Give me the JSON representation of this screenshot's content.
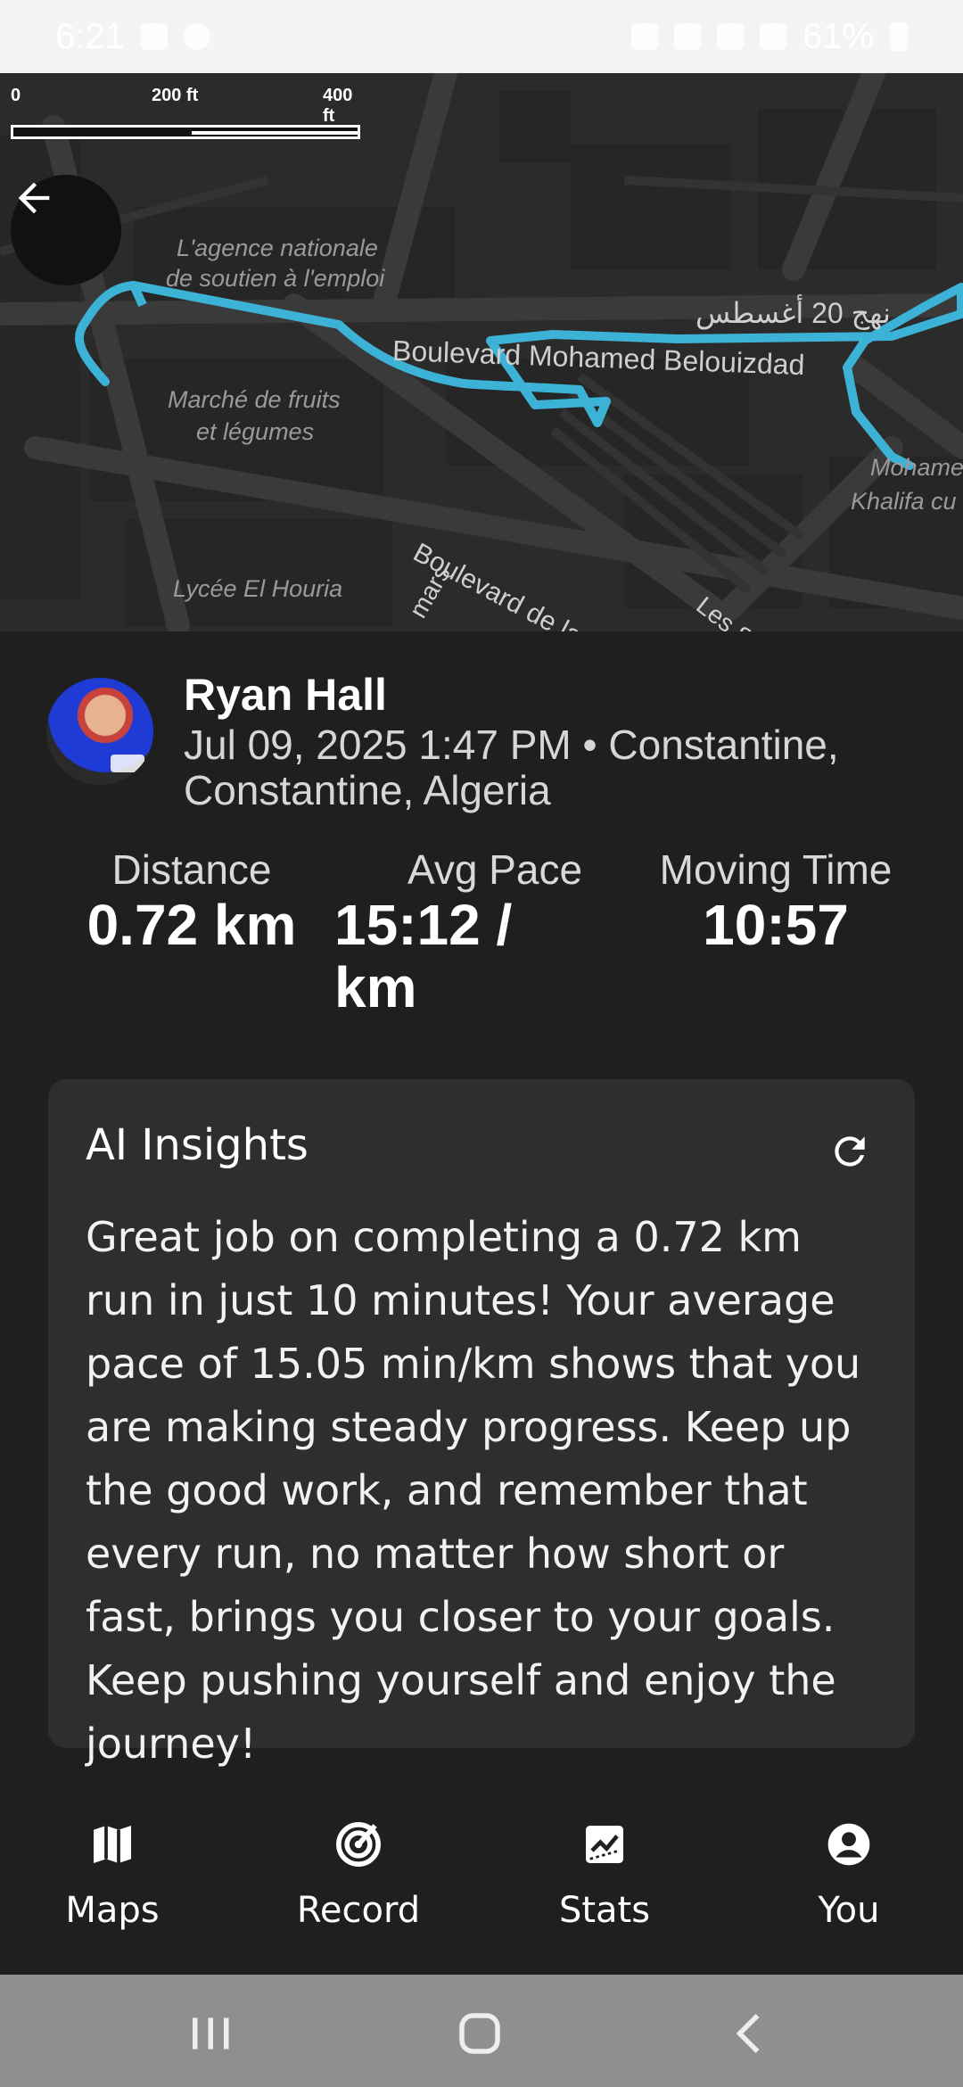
{
  "status_bar": {
    "time": "6:21",
    "battery": "61%"
  },
  "map": {
    "scale_labels": [
      "0",
      "200 ft",
      "400 ft"
    ],
    "labels": [
      "L'agence nationale",
      "de soutien à l'emploi",
      "Marché de fruits",
      "et légumes",
      "Boulevard Mohamed Belouizdad",
      "Boulevard de la Liberté",
      "Les SS",
      "Lycée El Houria",
      "Mohamed",
      "Khalifa cu",
      "نهج 20 أغسطس",
      "mars"
    ],
    "route_color": "#3cb3d6"
  },
  "profile": {
    "name": "Ryan Hall",
    "meta": "Jul 09, 2025 1:47 PM • Constantine, Constantine, Algeria"
  },
  "stats": {
    "distance_label": "Distance",
    "distance_value": "0.72 km",
    "pace_label": "Avg Pace",
    "pace_value": "15:12 / km",
    "time_label": "Moving Time",
    "time_value": "10:57"
  },
  "insights": {
    "title": "AI Insights",
    "text": " Great job on completing a 0.72 km run in just 10 minutes! Your average pace of 15.05 min/km shows that you are making steady progress. Keep up the good work, and remember that every run, no matter how short or fast, brings you closer to your goals. Keep pushing yourself and enjoy the journey!"
  },
  "nav": {
    "items": [
      {
        "label": "Maps",
        "icon": "map-icon"
      },
      {
        "label": "Record",
        "icon": "record-icon"
      },
      {
        "label": "Stats",
        "icon": "stats-icon"
      },
      {
        "label": "You",
        "icon": "person-icon"
      }
    ]
  }
}
